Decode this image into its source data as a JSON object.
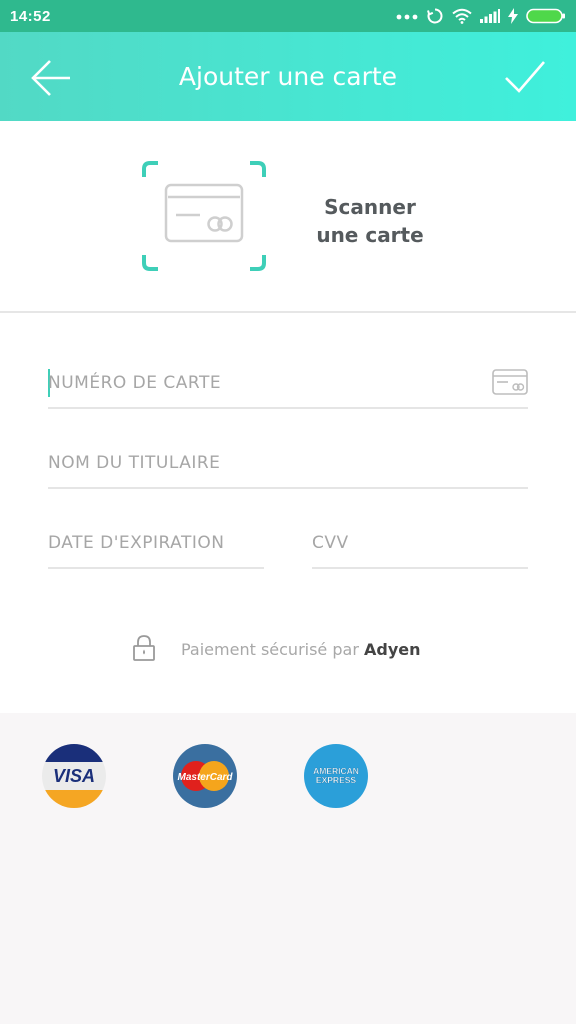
{
  "status_bar": {
    "time": "14:52",
    "icons": [
      "more-dots-icon",
      "sync-icon",
      "wifi-icon",
      "signal-icon",
      "charging-icon",
      "battery-icon"
    ],
    "color": "#2fb98e"
  },
  "app_bar": {
    "title": "Ajouter une carte",
    "back_icon": "arrow-left-icon",
    "confirm_icon": "check-icon",
    "gradient": [
      "#52d9c5",
      "#3ff0dc"
    ]
  },
  "scan": {
    "line1": "Scanner",
    "line2": "une carte",
    "icon": "card-scan-icon",
    "accent": "#3ecfb8"
  },
  "form": {
    "card_number_placeholder": "NUMÉRO DE CARTE",
    "holder_placeholder": "NOM DU TITULAIRE",
    "expiry_placeholder": "DATE D'EXPIRATION",
    "cvv_placeholder": "CVV"
  },
  "secure": {
    "text": "Paiement sécurisé par ",
    "brand": "Adyen"
  },
  "card_brands": {
    "visa": "VISA",
    "mastercard": "MasterCard",
    "amex_line1": "AMERICAN",
    "amex_line2": "EXPRESS"
  }
}
